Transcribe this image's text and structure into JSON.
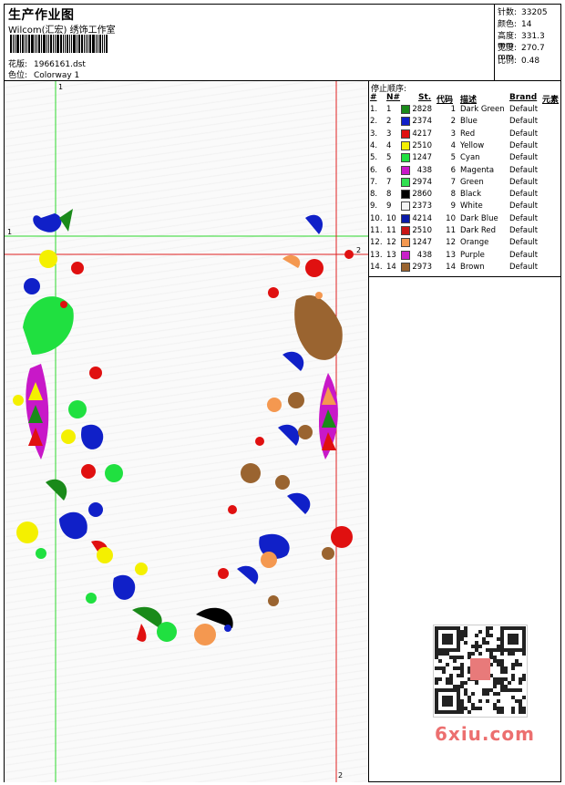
{
  "header": {
    "title": "生产作业图",
    "subtitle": "Wilcom(汇宏) 绣饰工作室",
    "design_label": "花版:",
    "design_value": "1966161.dst",
    "colorway_label": "色位:",
    "colorway_value": "Colorway 1"
  },
  "specs": [
    {
      "label": "针数:",
      "value": "33205"
    },
    {
      "label": "颜色:",
      "value": "14"
    },
    {
      "label": "高度:",
      "value": "331.3 mm"
    },
    {
      "label": "宽度:",
      "value": "270.7 mm"
    },
    {
      "label": "比例:",
      "value": "0.48"
    }
  ],
  "stop_sequence": {
    "title": "停止顺序:",
    "columns": [
      "#",
      "N#",
      "St.",
      "代码",
      "描述",
      "Brand",
      "元素"
    ],
    "rows": [
      {
        "n": "1.",
        "num": "1",
        "color": "#1a8a1a",
        "st": "2828",
        "code": "1",
        "desc": "Dark Green",
        "brand": "Default"
      },
      {
        "n": "2.",
        "num": "2",
        "color": "#1020c8",
        "st": "2374",
        "code": "2",
        "desc": "Blue",
        "brand": "Default"
      },
      {
        "n": "3.",
        "num": "3",
        "color": "#e01010",
        "st": "4217",
        "code": "3",
        "desc": "Red",
        "brand": "Default"
      },
      {
        "n": "4.",
        "num": "4",
        "color": "#f4f000",
        "st": "2510",
        "code": "4",
        "desc": "Yellow",
        "brand": "Default"
      },
      {
        "n": "5.",
        "num": "5",
        "color": "#20e040",
        "st": "1247",
        "code": "5",
        "desc": "Cyan",
        "brand": "Default"
      },
      {
        "n": "6.",
        "num": "6",
        "color": "#c818c8",
        "st": "438",
        "code": "6",
        "desc": "Magenta",
        "brand": "Default"
      },
      {
        "n": "7.",
        "num": "7",
        "color": "#30e050",
        "st": "2974",
        "code": "7",
        "desc": "Green",
        "brand": "Default"
      },
      {
        "n": "8.",
        "num": "8",
        "color": "#000000",
        "st": "2860",
        "code": "8",
        "desc": "Black",
        "brand": "Default"
      },
      {
        "n": "9.",
        "num": "9",
        "color": "#f4f4f4",
        "st": "2373",
        "code": "9",
        "desc": "White",
        "brand": "Default"
      },
      {
        "n": "10.",
        "num": "10",
        "color": "#0a1aa8",
        "st": "4214",
        "code": "10",
        "desc": "Dark Blue",
        "brand": "Default"
      },
      {
        "n": "11.",
        "num": "11",
        "color": "#c81414",
        "st": "2510",
        "code": "11",
        "desc": "Dark Red",
        "brand": "Default"
      },
      {
        "n": "12.",
        "num": "12",
        "color": "#f49850",
        "st": "1247",
        "code": "12",
        "desc": "Orange",
        "brand": "Default"
      },
      {
        "n": "13.",
        "num": "13",
        "color": "#c820c8",
        "st": "438",
        "code": "13",
        "desc": "Purple",
        "brand": "Default"
      },
      {
        "n": "14.",
        "num": "14",
        "color": "#9a6430",
        "st": "2973",
        "code": "14",
        "desc": "Brown",
        "brand": "Default"
      }
    ]
  },
  "guides": {
    "v1": "1",
    "h1": "1",
    "h2": "2",
    "v2": "2"
  },
  "watermark": "6xiu.com"
}
